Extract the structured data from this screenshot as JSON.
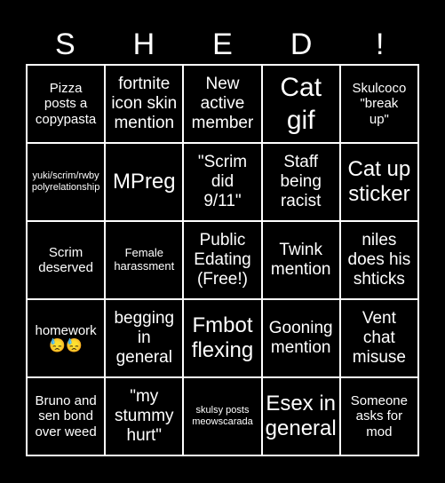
{
  "card": {
    "header": [
      "S",
      "H",
      "E",
      "D",
      "!"
    ],
    "cells": [
      {
        "text": "Pizza\nposts a\ncopypasta",
        "size": "md"
      },
      {
        "text": "fortnite\nicon skin\nmention",
        "size": "lg"
      },
      {
        "text": "New\nactive\nmember",
        "size": "lg"
      },
      {
        "text": "Cat\ngif",
        "size": "xxl"
      },
      {
        "text": "Skulcoco\n\"break\nup\"",
        "size": "md"
      },
      {
        "text": "yuki/scrim/rwby\npolyrelationship",
        "size": "xs"
      },
      {
        "text": "MPreg",
        "size": "xl"
      },
      {
        "text": "\"Scrim\ndid\n9/11\"",
        "size": "lg"
      },
      {
        "text": "Staff\nbeing\nracist",
        "size": "lg"
      },
      {
        "text": "Cat up\nsticker",
        "size": "xl"
      },
      {
        "text": "Scrim\ndeserved",
        "size": "md"
      },
      {
        "text": "Female\nharassment",
        "size": "sm"
      },
      {
        "text": "Public\nEdating\n(Free!)",
        "size": "lg"
      },
      {
        "text": "Twink\nmention",
        "size": "lg"
      },
      {
        "text": "niles\ndoes his\nshticks",
        "size": "lg"
      },
      {
        "text": "homework\n😓😓",
        "size": "md"
      },
      {
        "text": "begging\nin\ngeneral",
        "size": "lg"
      },
      {
        "text": "Fmbot\nflexing",
        "size": "xl"
      },
      {
        "text": "Gooning\nmention",
        "size": "lg"
      },
      {
        "text": "Vent\nchat\nmisuse",
        "size": "lg"
      },
      {
        "text": "Bruno and\nsen bond\nover weed",
        "size": "md"
      },
      {
        "text": "\"my\nstummy\nhurt\"",
        "size": "lg"
      },
      {
        "text": "skulsy posts\nmeowscarada",
        "size": "xs"
      },
      {
        "text": "Esex in\ngeneral",
        "size": "xl"
      },
      {
        "text": "Someone\nasks for\nmod",
        "size": "md"
      }
    ]
  }
}
